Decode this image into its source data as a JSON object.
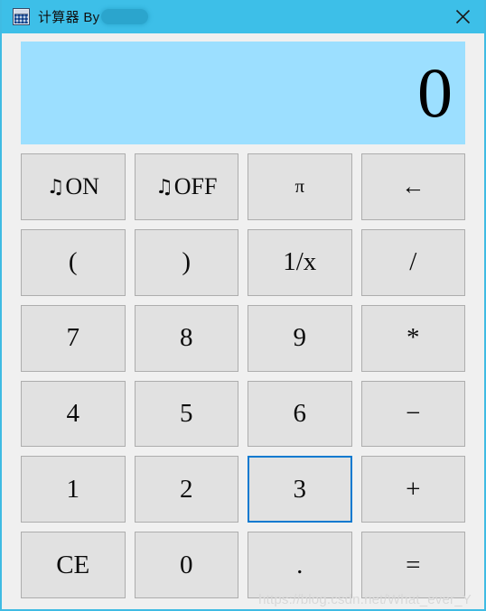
{
  "window": {
    "title": "计算器 By",
    "title_icon": "calculator-icon",
    "author_redacted": "",
    "titlebar_color": "#3dbfe8",
    "border_color": "#3fbbe3",
    "close_label": "✕"
  },
  "display": {
    "value": "0",
    "background": "#9cdfff",
    "text_color": "#000000"
  },
  "keypad": {
    "focused_key": "3",
    "focus_color": "#0a7ad0",
    "key_background": "#e1e1e1",
    "key_border": "#adadad",
    "rows": [
      [
        {
          "label": "ON",
          "note": "♫",
          "name": "sound-on-button",
          "size": "music"
        },
        {
          "label": "OFF",
          "note": "♫",
          "name": "sound-off-button",
          "size": "music"
        },
        {
          "label": "π",
          "note": "",
          "name": "pi-button",
          "size": "small"
        },
        {
          "label": "←",
          "note": "",
          "name": "backspace-button",
          "size": "arrow"
        }
      ],
      [
        {
          "label": "(",
          "note": "",
          "name": "open-paren-button",
          "size": ""
        },
        {
          "label": ")",
          "note": "",
          "name": "close-paren-button",
          "size": ""
        },
        {
          "label": "1/x",
          "note": "",
          "name": "reciprocal-button",
          "size": ""
        },
        {
          "label": "/",
          "note": "",
          "name": "divide-button",
          "size": ""
        }
      ],
      [
        {
          "label": "7",
          "note": "",
          "name": "digit-7-button",
          "size": ""
        },
        {
          "label": "8",
          "note": "",
          "name": "digit-8-button",
          "size": ""
        },
        {
          "label": "9",
          "note": "",
          "name": "digit-9-button",
          "size": ""
        },
        {
          "label": "*",
          "note": "",
          "name": "multiply-button",
          "size": ""
        }
      ],
      [
        {
          "label": "4",
          "note": "",
          "name": "digit-4-button",
          "size": ""
        },
        {
          "label": "5",
          "note": "",
          "name": "digit-5-button",
          "size": ""
        },
        {
          "label": "6",
          "note": "",
          "name": "digit-6-button",
          "size": ""
        },
        {
          "label": "−",
          "note": "",
          "name": "subtract-button",
          "size": ""
        }
      ],
      [
        {
          "label": "1",
          "note": "",
          "name": "digit-1-button",
          "size": ""
        },
        {
          "label": "2",
          "note": "",
          "name": "digit-2-button",
          "size": ""
        },
        {
          "label": "3",
          "note": "",
          "name": "digit-3-button",
          "size": ""
        },
        {
          "label": "+",
          "note": "",
          "name": "add-button",
          "size": ""
        }
      ],
      [
        {
          "label": "CE",
          "note": "",
          "name": "clear-entry-button",
          "size": ""
        },
        {
          "label": "0",
          "note": "",
          "name": "digit-0-button",
          "size": ""
        },
        {
          "label": ".",
          "note": "",
          "name": "decimal-point-button",
          "size": ""
        },
        {
          "label": "=",
          "note": "",
          "name": "equals-button",
          "size": ""
        }
      ]
    ]
  },
  "watermark": {
    "text": "https://blog.csdn.net/What_ever_Y"
  }
}
